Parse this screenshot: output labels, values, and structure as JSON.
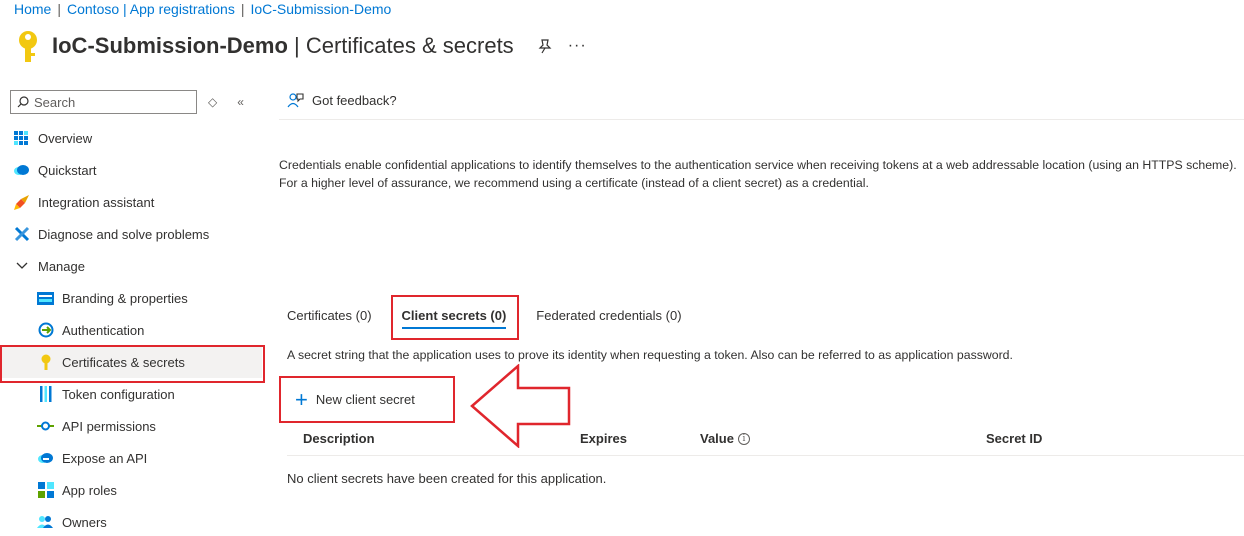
{
  "breadcrumb": [
    "Home",
    "Contoso | App registrations",
    "IoC-Submission-Demo"
  ],
  "header": {
    "app_name": "IoC-Submission-Demo",
    "separator_page": " | Certificates & secrets",
    "more": "···"
  },
  "sidebar": {
    "search_placeholder": "Search",
    "items": [
      {
        "label": "Overview",
        "icon": "grid-icon"
      },
      {
        "label": "Quickstart",
        "icon": "cloud-icon"
      },
      {
        "label": "Integration assistant",
        "icon": "rocket-icon"
      },
      {
        "label": "Diagnose and solve problems",
        "icon": "wrench-icon"
      },
      {
        "label": "Manage",
        "icon": "chevron-down-icon"
      },
      {
        "label": "Branding & properties",
        "icon": "branding-icon"
      },
      {
        "label": "Authentication",
        "icon": "authentication-icon"
      },
      {
        "label": "Certificates & secrets",
        "icon": "key-icon"
      },
      {
        "label": "Token configuration",
        "icon": "token-icon"
      },
      {
        "label": "API permissions",
        "icon": "api-icon"
      },
      {
        "label": "Expose an API",
        "icon": "cloud-api-icon"
      },
      {
        "label": "App roles",
        "icon": "app-roles-icon"
      },
      {
        "label": "Owners",
        "icon": "owners-icon"
      }
    ]
  },
  "main": {
    "feedback": "Got feedback?",
    "description": "Credentials enable confidential applications to identify themselves to the authentication service when receiving tokens at a web addressable location (using an HTTPS scheme). For a higher level of assurance, we recommend using a certificate (instead of a client secret) as a credential.",
    "tabs": [
      "Certificates (0)",
      "Client secrets (0)",
      "Federated credentials (0)"
    ],
    "secret_description": "A secret string that the application uses to prove its identity when requesting a token. Also can be referred to as application password.",
    "new_button": "New client secret",
    "columns": [
      "Description",
      "Expires",
      "Value",
      "Secret ID"
    ],
    "empty_message": "No client secrets have been created for this application."
  },
  "colors": {
    "accent": "#0078d4",
    "highlight": "#e0262d"
  }
}
